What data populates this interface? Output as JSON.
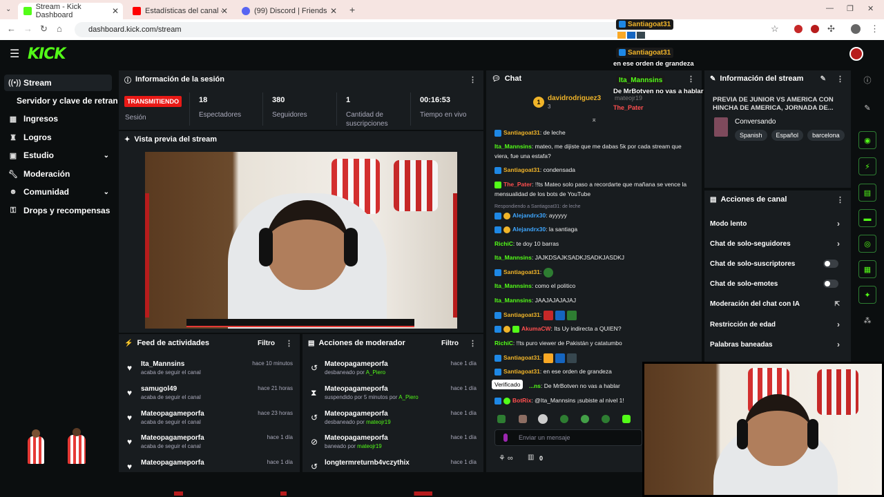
{
  "browser": {
    "tabs": [
      {
        "label": "Stream - Kick Dashboard",
        "color": "#53fc18"
      },
      {
        "label": "Estadísticas del canal - YouTube",
        "color": "#ff0000"
      },
      {
        "label": "(99) Discord | Friends",
        "color": "#5865f2"
      }
    ],
    "url": "dashboard.kick.com/stream"
  },
  "brand": {
    "logo": "KICK",
    "accent": "#53fc18"
  },
  "sidebar": {
    "items": [
      {
        "label": "Stream",
        "icon": "broadcast-icon"
      },
      {
        "label": "Servidor y clave de retransm",
        "icon": ""
      },
      {
        "label": "Ingresos",
        "icon": "money-icon"
      },
      {
        "label": "Logros",
        "icon": "trophy-icon"
      },
      {
        "label": "Estudio",
        "icon": "studio-icon"
      },
      {
        "label": "Moderación",
        "icon": "wrench-icon"
      },
      {
        "label": "Comunidad",
        "icon": "people-icon"
      },
      {
        "label": "Drops y recompensas",
        "icon": "gift-icon"
      }
    ]
  },
  "session": {
    "title": "Información de la sesión",
    "status": "TRANSMITIENDO",
    "status_label": "Sesión",
    "stats": [
      {
        "value": "18",
        "label": "Espectadores"
      },
      {
        "value": "380",
        "label": "Seguidores"
      },
      {
        "value": "1",
        "label": "Cantidad de suscripciones"
      },
      {
        "value": "00:16:53",
        "label": "Tiempo en vivo"
      }
    ]
  },
  "preview": {
    "title": "Vista previa del stream"
  },
  "feed": {
    "title": "Feed de actividades",
    "filter": "Filtro",
    "rows": [
      {
        "name": "Ita_Mannsins",
        "sub": "acaba de seguir el canal",
        "time": "hace 10 minutos"
      },
      {
        "name": "samugol49",
        "sub": "acaba de seguir el canal",
        "time": "hace 21 horas"
      },
      {
        "name": "Mateopagameporfa",
        "sub": "acaba de seguir el canal",
        "time": "hace 23 horas"
      },
      {
        "name": "Mateopagameporfa",
        "sub": "acaba de seguir el canal",
        "time": "hace 1 día"
      },
      {
        "name": "Mateopagameporfa",
        "sub": "",
        "time": "hace 1 día"
      }
    ]
  },
  "modactions": {
    "title": "Acciones de moderador",
    "filter": "Filtro",
    "rows": [
      {
        "name": "Mateopagameporfa",
        "sub": "desbaneado por",
        "by": "A_Piero",
        "time": "hace 1 día",
        "icon": "undo-icon"
      },
      {
        "name": "Mateopagameporfa",
        "sub": "suspendido por 5 minutos por",
        "by": "A_Piero",
        "time": "hace 1 día",
        "icon": "hourglass-icon"
      },
      {
        "name": "Mateopagameporfa",
        "sub": "desbaneado por",
        "by": "mateojr19",
        "time": "hace 1 día",
        "icon": "undo-icon"
      },
      {
        "name": "Mateopagameporfa",
        "sub": "baneado por",
        "by": "mateojr19",
        "time": "hace 1 día",
        "icon": "ban-icon"
      },
      {
        "name": "longtermreturnb4vczythix",
        "sub": "",
        "by": "",
        "time": "hace 1 día",
        "icon": "undo-icon"
      }
    ]
  },
  "chat": {
    "title": "Chat",
    "pinned_user": "davidrodriguez3",
    "pinned_count": "3",
    "top_users": [
      "mateojr19",
      "The_Pater"
    ],
    "replying": "Respondiendo a Santiagoat31: de leche",
    "messages": [
      {
        "user": "Santiagoat31",
        "text": ": de leche",
        "color": "gold"
      },
      {
        "user": "Ita_Mannsins",
        "text": ": mateo, me dijiste que me dabas 5k por cada stream que viera, fue una estafa?",
        "color": "g"
      },
      {
        "user": "Santiagoat31",
        "text": ": condensada",
        "color": "gold"
      },
      {
        "user": "The_Pater",
        "text": ": !!ts Mateo solo paso a recordarte que mañana se vence la mensualidad de los bots de YouTube",
        "color": "r"
      },
      {
        "user": "Alejandrx30",
        "text": ": ayyyyy",
        "color": "b"
      },
      {
        "user": "Alejandrx30",
        "text": ": la santiaga",
        "color": "b"
      },
      {
        "user": "RichiC",
        "text": ": te doy 10 barras",
        "color": "g"
      },
      {
        "user": "Ita_Mannsins",
        "text": ": JAJKDSAJKSADKJSADKJASDKJ",
        "color": "g"
      },
      {
        "user": "Santiagoat31",
        "text": ":",
        "color": "gold"
      },
      {
        "user": "Ita_Mannsins",
        "text": ": como el politico",
        "color": "g"
      },
      {
        "user": "Ita_Mannsins",
        "text": ": JAAJAJAJAJAJ",
        "color": "g"
      },
      {
        "user": "Santiagoat31",
        "text": ":",
        "color": "gold"
      },
      {
        "user": "AkumaCW",
        "text": ": Its Uy indirecta a QUIEN?",
        "color": "r"
      },
      {
        "user": "RichiC",
        "text": ": !!ts puro viewer de Pakistán y catatumbo",
        "color": "g"
      },
      {
        "user": "Santiagoat31",
        "text": ":",
        "color": "gold"
      },
      {
        "user": "Santiagoat31",
        "text": ": en ese orden de grandeza",
        "color": "gold"
      },
      {
        "user": "...ns",
        "text": ": De MrBotven no vas a hablar",
        "color": "g"
      },
      {
        "user": "BotRix",
        "text": ": @Ita_Mannsins ¡subiste al nivel 1!",
        "color": "r"
      }
    ],
    "tooltip": "Verificado",
    "input_placeholder": "Enviar un mensaje",
    "footer_count": "0"
  },
  "overlay": {
    "users": [
      "Santiagoat31",
      "Santiagoat31",
      "Ita_Mannsins"
    ],
    "texts": [
      "en ese orden de grandeza",
      "De MrBotven no vas a hablar"
    ]
  },
  "streaminfo": {
    "title": "Información del stream",
    "stream_title": "PREVIA DE JUNIOR VS AMERICA CON HINCHA DE AMERICA, JORNADA DE...",
    "category": "Conversando",
    "tags": [
      "Spanish",
      "Español",
      "barcelona"
    ]
  },
  "channel_actions": {
    "title": "Acciones de canal",
    "items": [
      {
        "label": "Modo lento",
        "control": "chevron"
      },
      {
        "label": "Chat de solo-seguidores",
        "control": "chevron"
      },
      {
        "label": "Chat de solo-suscriptores",
        "control": "toggle"
      },
      {
        "label": "Chat de solo-emotes",
        "control": "toggle"
      },
      {
        "label": "Moderación del chat con IA",
        "control": "external"
      },
      {
        "label": "Restricción de edad",
        "control": "chevron"
      },
      {
        "label": "Palabras baneadas",
        "control": "chevron"
      }
    ]
  }
}
